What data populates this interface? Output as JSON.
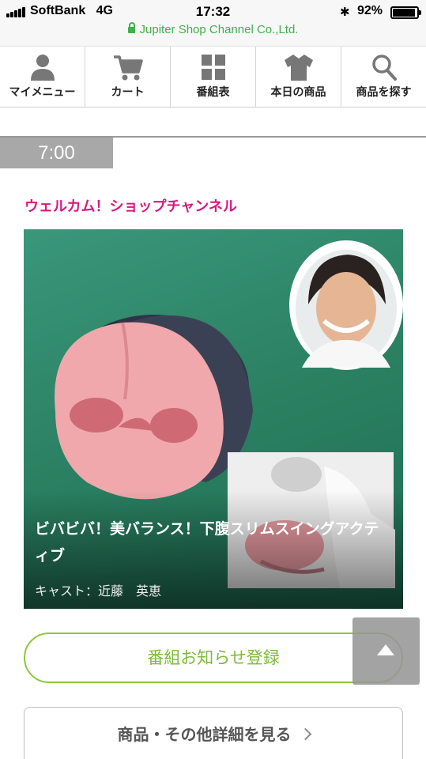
{
  "status_bar": {
    "carrier": "SoftBank",
    "network": "4G",
    "time": "17:32",
    "battery_percent": "92%",
    "battery_level": 0.92,
    "url": "Jupiter Shop Channel Co.,Ltd."
  },
  "nav": {
    "items": [
      {
        "label": "マイメニュー",
        "icon": "person-icon"
      },
      {
        "label": "カート",
        "icon": "cart-icon"
      },
      {
        "label": "番組表",
        "icon": "grid-icon"
      },
      {
        "label": "本日の商品",
        "icon": "shirt-icon"
      },
      {
        "label": "商品を探す",
        "icon": "search-icon"
      }
    ]
  },
  "schedule": {
    "time": "7:00",
    "program_title": "ウェルカム！ショップチャンネル",
    "product_name": "ビバビバ！美バランス！下腹スリムスイングアクティブ",
    "cast": "キャスト：近藤　英恵"
  },
  "buttons": {
    "notify": "番組お知らせ登録",
    "details": "商品・その他詳細を見る"
  },
  "colors": {
    "accent_green": "#8dc63f",
    "title_magenta": "#d6197e",
    "url_green": "#3fb14b",
    "hero_green": "#2f8668"
  }
}
